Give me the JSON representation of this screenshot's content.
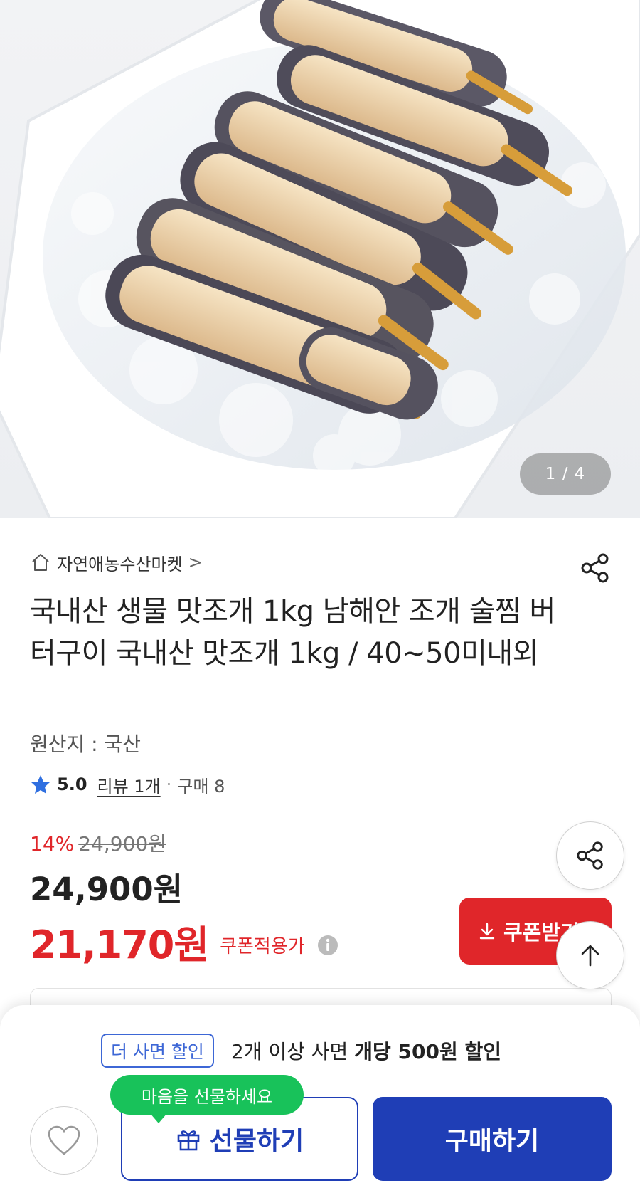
{
  "product_image": {
    "counter": "1 / 4"
  },
  "store": {
    "name": "자연애농수산마켓",
    "chevron": ">"
  },
  "product": {
    "title": "국내산 생물 맛조개 1kg 남해안 조개 술찜 버터구이 국내산 맛조개 1kg / 40~50미내외",
    "origin": "원산지 : 국산"
  },
  "rating": {
    "score": "5.0",
    "reviews": "리뷰 1개",
    "separator": "·",
    "purchases": "구매 8"
  },
  "pricing": {
    "discount_percent": "14%",
    "original_price": "24,900원",
    "price": "24,900원",
    "coupon_price": "21,170원",
    "coupon_label": "쿠폰적용가",
    "coupon_button": "쿠폰받기"
  },
  "bulk_discount": {
    "tag": "더 사면 할인",
    "message_prefix": "2개 이상 사면 ",
    "message_bold": "개당 500원 할인"
  },
  "actions": {
    "gift_bubble": "마음을 선물하세요",
    "gift_button": "선물하기",
    "buy_button": "구매하기"
  },
  "colors": {
    "accent_red": "#e0262a",
    "brand_blue": "#1f3eb6",
    "bubble_green": "#18c25a",
    "star_blue": "#2f6fe0"
  },
  "icons": [
    "home-icon",
    "share-icon",
    "star-icon",
    "info-icon",
    "download-icon",
    "arrow-up-icon",
    "heart-icon",
    "gift-icon"
  ]
}
